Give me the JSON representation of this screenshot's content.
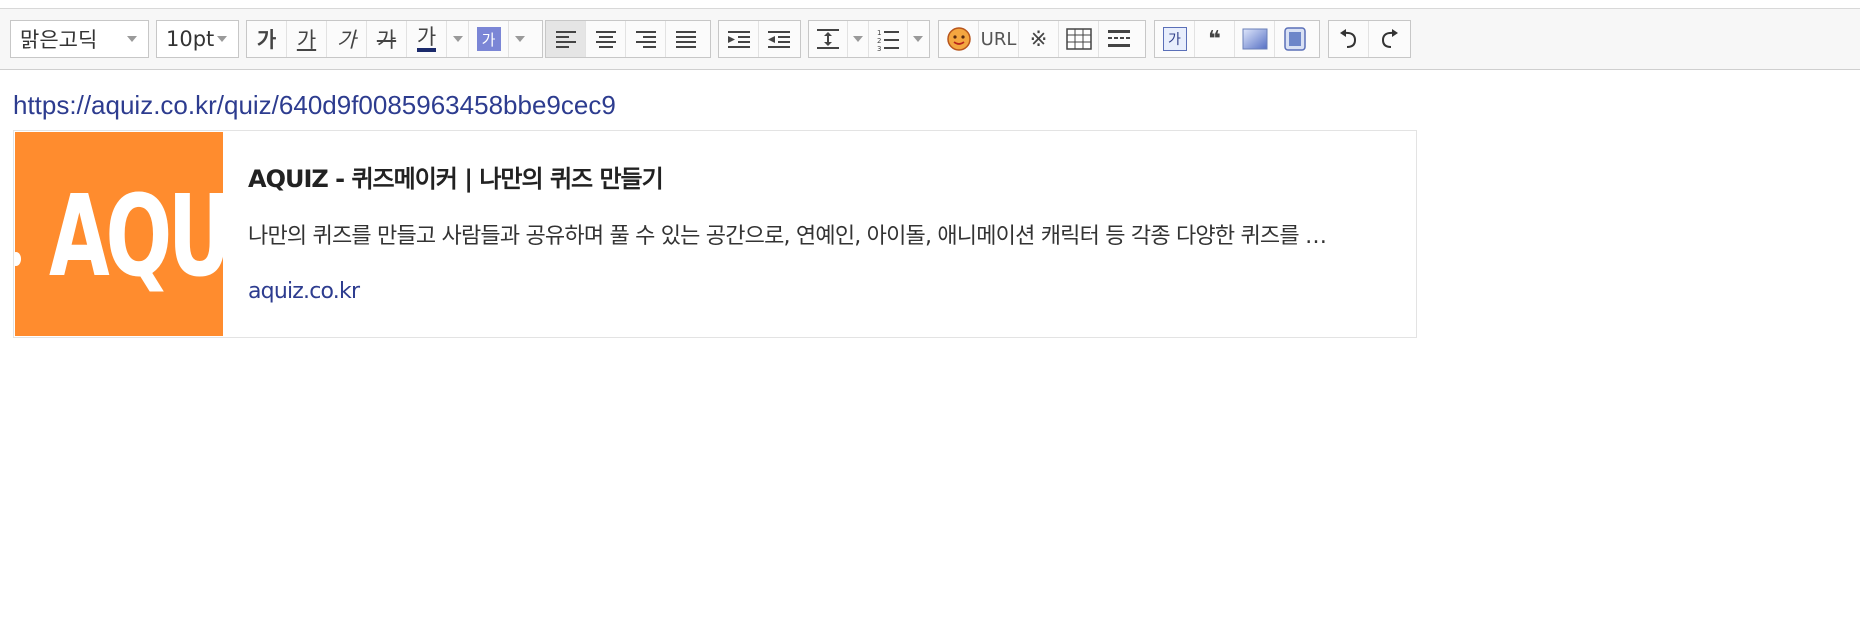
{
  "toolbar": {
    "font_family": "맑은고딕",
    "font_size": "10pt",
    "bold_label": "가",
    "underline_label": "가",
    "italic_label": "가",
    "strike_label": "가",
    "font_color_label": "가",
    "bg_color_label": "가",
    "url_label": "URL",
    "special_char_label": "※",
    "text_box_label": "가",
    "quote_label": "❝",
    "colors": {
      "font_color_bar": "#1b2a6b",
      "bg_color_swatch": "#7b86d6"
    }
  },
  "content": {
    "url_text": "https://aquiz.co.kr/quiz/640d9f0085963458bbe9cec9",
    "preview": {
      "thumbnail_text": "AQUI",
      "thumbnail_color": "#ff8c2e",
      "title": "AQUIZ - 퀴즈메이커 | 나만의 퀴즈 만들기",
      "description": "나만의 퀴즈를 만들고 사람들과 공유하며 풀 수 있는 공간으로, 연예인, 아이돌, 애니메이션 캐릭터 등 각종 다양한 퀴즈를 …",
      "domain": "aquiz.co.kr"
    }
  }
}
